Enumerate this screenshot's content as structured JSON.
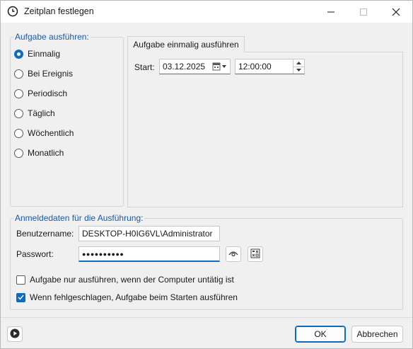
{
  "window": {
    "title": "Zeitplan festlegen"
  },
  "run_group": {
    "legend": "Aufgabe ausführen:",
    "options": [
      {
        "label": "Einmalig",
        "checked": true
      },
      {
        "label": "Bei Ereignis",
        "checked": false
      },
      {
        "label": "Periodisch",
        "checked": false
      },
      {
        "label": "Täglich",
        "checked": false
      },
      {
        "label": "Wöchentlich",
        "checked": false
      },
      {
        "label": "Monatlich",
        "checked": false
      }
    ]
  },
  "tab": {
    "label": "Aufgabe einmalig ausführen",
    "start_label": "Start:",
    "date_value": "03.12.2025",
    "time_value": "12:00:00"
  },
  "credentials": {
    "legend": "Anmeldedaten für die Ausführung:",
    "username_label": "Benutzername:",
    "username_value": "DESKTOP-H0IG6VL\\Administrator",
    "password_label": "Passwort:",
    "password_value": "●●●●●●●●●●"
  },
  "options": {
    "idle_only_label": "Aufgabe nur ausführen, wenn der Computer untätig ist",
    "idle_only_checked": false,
    "run_on_start_label": "Wenn fehlgeschlagen, Aufgabe beim Starten ausführen",
    "run_on_start_checked": true
  },
  "footer": {
    "ok_label": "OK",
    "cancel_label": "Abbrechen"
  },
  "colors": {
    "accent": "#0f6cbd",
    "legend_text": "#1a5aa6"
  }
}
